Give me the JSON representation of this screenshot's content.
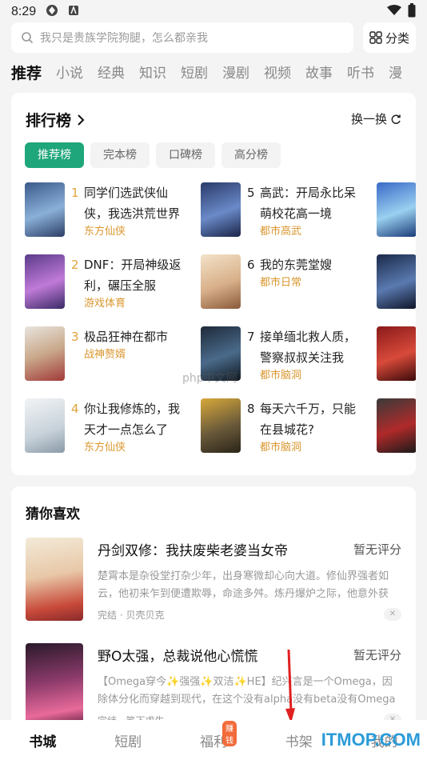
{
  "status_bar": {
    "time": "8:29"
  },
  "search": {
    "placeholder": "我只是贵族学院狗腿，怎么都亲我",
    "category_label": "分类"
  },
  "tabs": [
    "推荐",
    "小说",
    "经典",
    "知识",
    "短剧",
    "漫剧",
    "视频",
    "故事",
    "听书",
    "漫"
  ],
  "ranking": {
    "title": "排行榜",
    "switch_label": "换一换",
    "chips": [
      "推荐榜",
      "完本榜",
      "口碑榜",
      "高分榜"
    ],
    "items": [
      {
        "rank": "1",
        "title": "同学们选武侠仙侠，我选洪荒世界",
        "tag": "东方仙侠"
      },
      {
        "rank": "2",
        "title": "DNF：开局神级返利，碾压全服",
        "tag": "游戏体育"
      },
      {
        "rank": "3",
        "title": "极品狂神在都市",
        "tag": "战神赘婿"
      },
      {
        "rank": "4",
        "title": "你让我修炼的，我天才一点怎么了",
        "tag": "东方仙侠"
      },
      {
        "rank": "5",
        "title": "高武：开局永比呆萌校花高一境",
        "tag": "都市高武"
      },
      {
        "rank": "6",
        "title": "我的东莞堂嫂",
        "tag": "都市日常"
      },
      {
        "rank": "7",
        "title": "接单缅北救人质，警察叔叔关注我",
        "tag": "都市脑洞"
      },
      {
        "rank": "8",
        "title": "每天六千万，只能在县城花?",
        "tag": "都市脑洞"
      }
    ]
  },
  "guess": {
    "title": "猜你喜欢",
    "books": [
      {
        "title": "丹剑双修：我扶废柴老婆当女帝",
        "score": "暂无评分",
        "desc": "楚霄本是杂役堂打杂少年，出身寒微却心向大道。修仙界强者如云，他初来乍到便遭欺辱，命途多舛。炼丹爆炉之际，他意外获得...",
        "meta": "完结 · 贝壳贝克"
      },
      {
        "title": "野O太强，总裁说他心慌慌",
        "score": "暂无评分",
        "desc": "【Omega穿今✨强强✨双洁✨HE】纪兴言是一个Omega，因除体分化而穿越到现代，在这个没有alpha没有beta没有Omega的...",
        "meta": "完结 · 笔下求生"
      }
    ]
  },
  "bottom_nav": {
    "items": [
      "书城",
      "短剧",
      "福利",
      "书架",
      "我的"
    ],
    "badge": "赚钱"
  },
  "watermarks": {
    "center": "php中文网",
    "corner": "ITMOP.COM"
  },
  "colors": {
    "accent": "#1fa67a",
    "rank_orange": "#e0a33a",
    "tag_orange": "#d9972f"
  }
}
